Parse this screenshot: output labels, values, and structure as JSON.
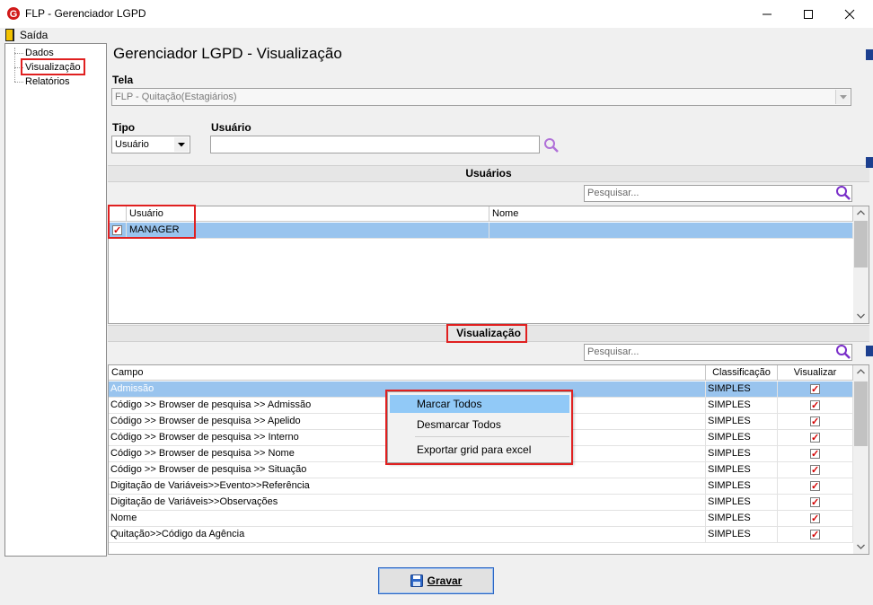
{
  "window": {
    "title": "FLP - Gerenciador LGPD"
  },
  "menu": {
    "exit_label": "Saída"
  },
  "tree": {
    "items": [
      "Dados",
      "Visualização",
      "Relatórios"
    ]
  },
  "page": {
    "title": "Gerenciador LGPD - Visualização"
  },
  "tela": {
    "label": "Tela",
    "value": "FLP - Quitação(Estagiários)"
  },
  "tipo": {
    "label": "Tipo",
    "value": "Usuário"
  },
  "usuario": {
    "label": "Usuário",
    "value": ""
  },
  "users_section": {
    "title": "Usuários",
    "search_placeholder": "Pesquisar...",
    "columns": [
      "Usuário",
      "Nome"
    ],
    "rows": [
      {
        "usuario": "MANAGER",
        "nome": "",
        "checked": true
      }
    ]
  },
  "visual_section": {
    "title": "Visualização",
    "search_placeholder": "Pesquisar...",
    "columns": [
      "Campo",
      "Classificação",
      "Visualizar"
    ],
    "rows": [
      {
        "campo": "Admissão",
        "classificacao": "SIMPLES",
        "visualizar": true
      },
      {
        "campo": "Código >> Browser de pesquisa >> Admissão",
        "classificacao": "SIMPLES",
        "visualizar": true
      },
      {
        "campo": "Código >> Browser de pesquisa >> Apelido",
        "classificacao": "SIMPLES",
        "visualizar": true
      },
      {
        "campo": "Código >> Browser de pesquisa >> Interno",
        "classificacao": "SIMPLES",
        "visualizar": true
      },
      {
        "campo": "Código >> Browser de pesquisa >> Nome",
        "classificacao": "SIMPLES",
        "visualizar": true
      },
      {
        "campo": "Código >> Browser de pesquisa >> Situação",
        "classificacao": "SIMPLES",
        "visualizar": true
      },
      {
        "campo": "Digitação de Variáveis>>Evento>>Referência",
        "classificacao": "SIMPLES",
        "visualizar": true
      },
      {
        "campo": "Digitação de Variáveis>>Observações",
        "classificacao": "SIMPLES",
        "visualizar": true
      },
      {
        "campo": "Nome",
        "classificacao": "SIMPLES",
        "visualizar": true
      },
      {
        "campo": "Quitação>>Código da Agência",
        "classificacao": "SIMPLES",
        "visualizar": true
      }
    ]
  },
  "context_menu": {
    "items": [
      "Marcar Todos",
      "Desmarcar Todos",
      "Exportar grid para excel"
    ]
  },
  "footer": {
    "save_label": "Gravar"
  },
  "colors": {
    "selection": "#99c4ee",
    "highlight_border": "#e02020",
    "search_icon": "#7a2fc9"
  }
}
